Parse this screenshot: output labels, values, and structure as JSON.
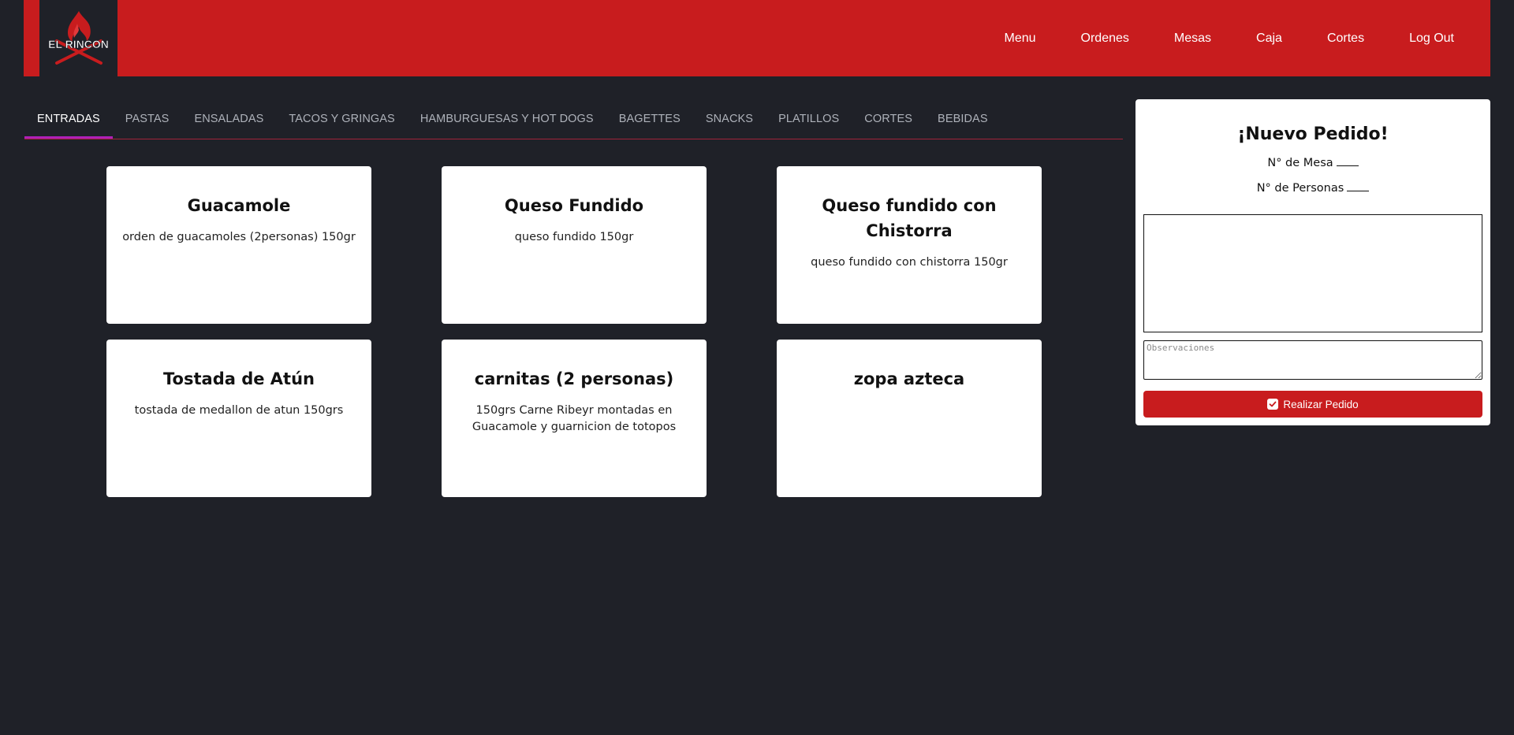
{
  "brand": {
    "logo_text": "EL RINCON",
    "accent": "#c81c1e"
  },
  "nav": {
    "items": [
      {
        "label": "Menu"
      },
      {
        "label": "Ordenes"
      },
      {
        "label": "Mesas"
      },
      {
        "label": "Caja"
      },
      {
        "label": "Cortes"
      },
      {
        "label": "Log Out"
      }
    ]
  },
  "tabs": {
    "active": "ENTRADAS",
    "items": [
      {
        "label": "ENTRADAS"
      },
      {
        "label": "PASTAS"
      },
      {
        "label": "ENSALADAS"
      },
      {
        "label": "TACOS Y GRINGAS"
      },
      {
        "label": "HAMBURGUESAS Y HOT DOGS"
      },
      {
        "label": "BAGETTES"
      },
      {
        "label": "SNACKS"
      },
      {
        "label": "PLATILLOS"
      },
      {
        "label": "CORTES"
      },
      {
        "label": "BEBIDAS"
      }
    ]
  },
  "menu_items": [
    {
      "name": "Guacamole",
      "description": "orden de guacamoles (2personas) 150gr"
    },
    {
      "name": "Queso Fundido",
      "description": "queso fundido 150gr"
    },
    {
      "name": "Queso fundido con Chistorra",
      "description": "queso fundido con chistorra 150gr"
    },
    {
      "name": "Tostada de Atún",
      "description": "tostada de medallon de atun 150grs"
    },
    {
      "name": "carnitas (2 personas)",
      "description": "150grs Carne Ribeyr montadas en Guacamole y guarnicion de totopos"
    },
    {
      "name": "zopa azteca",
      "description": ""
    }
  ],
  "order": {
    "title": "¡Nuevo Pedido!",
    "table_label": "N° de Mesa",
    "people_label": "N° de Personas",
    "notes_placeholder": "Observaciones",
    "submit_label": "Realizar Pedido"
  }
}
